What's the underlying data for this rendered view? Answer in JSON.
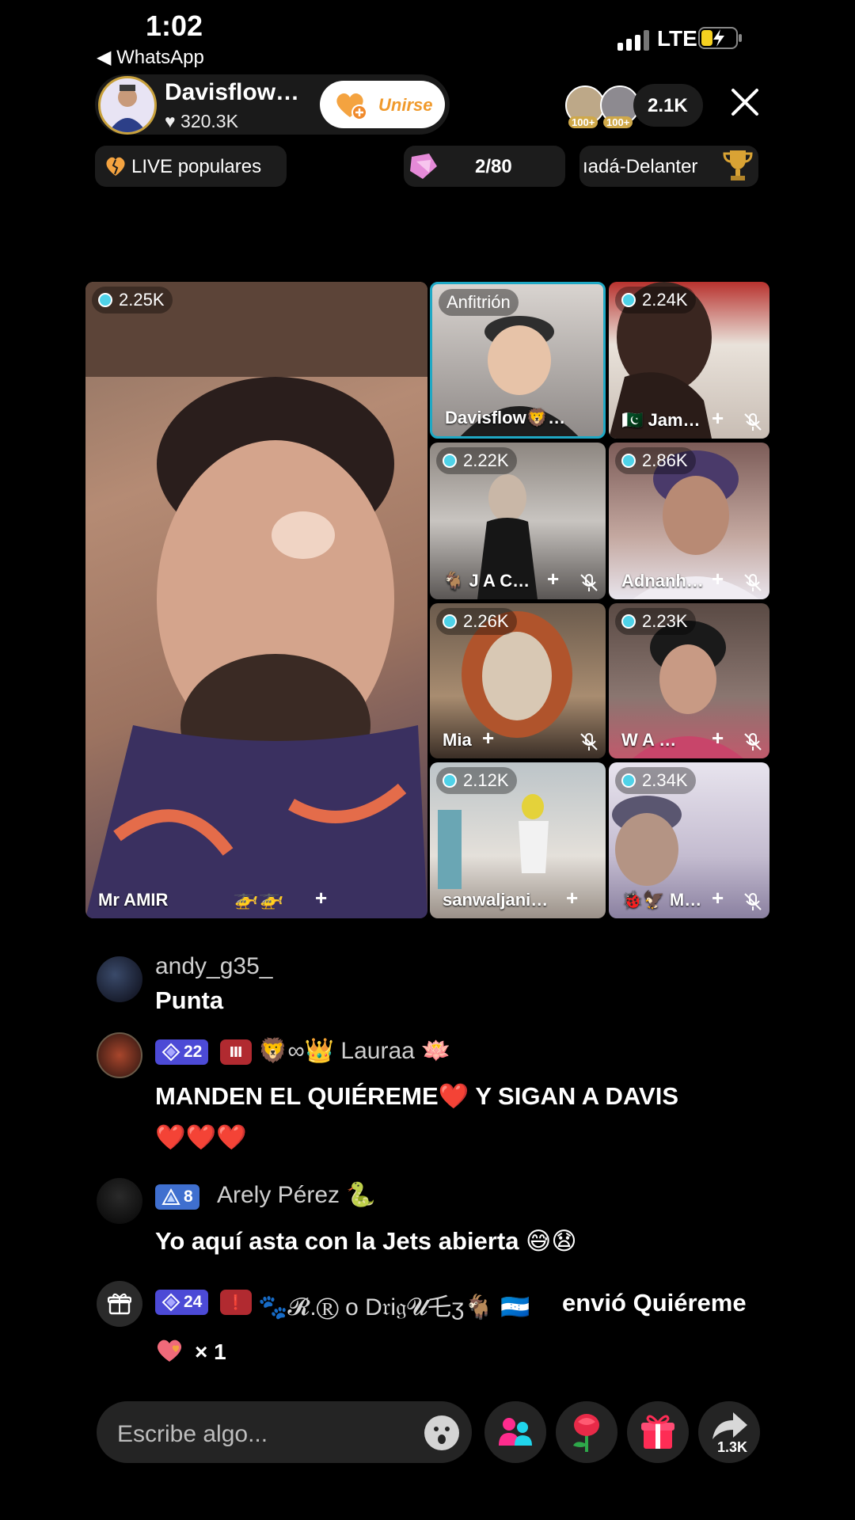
{
  "status_bar": {
    "time": "1:02",
    "back_app": "◀ WhatsApp",
    "network": "LTE"
  },
  "host": {
    "name": "Davisflow…",
    "likes": "320.3K",
    "join_label": "Unirse",
    "viewer_badges": [
      "100+",
      "100+"
    ],
    "viewer_count": "2.1K"
  },
  "tags": {
    "live": "LIVE populares",
    "gift_progress": "2/80",
    "ranking": "ıadá-Delanter"
  },
  "grid": {
    "main": {
      "viewers": "2.25K",
      "name": "Mr AMIR"
    },
    "tiles": [
      {
        "label": "Anfitrión",
        "name": "Davisflow🦁…",
        "host": true
      },
      {
        "viewers": "2.24K",
        "name": "🇵🇰 Jam…"
      },
      {
        "viewers": "2.22K",
        "name": "🐐 J A C…"
      },
      {
        "viewers": "2.86K",
        "name": "Adnanh…"
      },
      {
        "viewers": "2.26K",
        "name": "Mia"
      },
      {
        "viewers": "2.23K",
        "name": "W A …"
      },
      {
        "viewers": "2.12K",
        "name": "sanwaljani…"
      },
      {
        "viewers": "2.34K",
        "name": "🐞🦅 M…"
      }
    ]
  },
  "chat": [
    {
      "user": "andy_g35_",
      "message": "Punta"
    },
    {
      "level": "22",
      "user": "🦁∞👑 Lauraa 🪷",
      "message": "MANDEN EL QUIÉREME❤️ Y SIGAN A DAVIS",
      "message2": "❤️❤️❤️"
    },
    {
      "level": "8",
      "user": "Arely  Pérez 🐍",
      "message": "Yo aquí asta con la Jets abierta 😅😧"
    },
    {
      "level": "24",
      "user": "🐾𝓡.Ⓡ o D𝔯i𝔤𝓤乇ʒ🐐 🇭🇳",
      "message": "envió Quiéreme",
      "count": "× 1"
    }
  ],
  "bottom": {
    "input_placeholder": "Escribe algo...",
    "share_count": "1.3K"
  },
  "colors": {
    "accent_orange": "#f09a2c",
    "live_badge_cyan": "#4fd2e8",
    "host_border": "#1fa8c4",
    "level_purple": "#4c4ad6",
    "level_blue": "#3f6fcf"
  }
}
